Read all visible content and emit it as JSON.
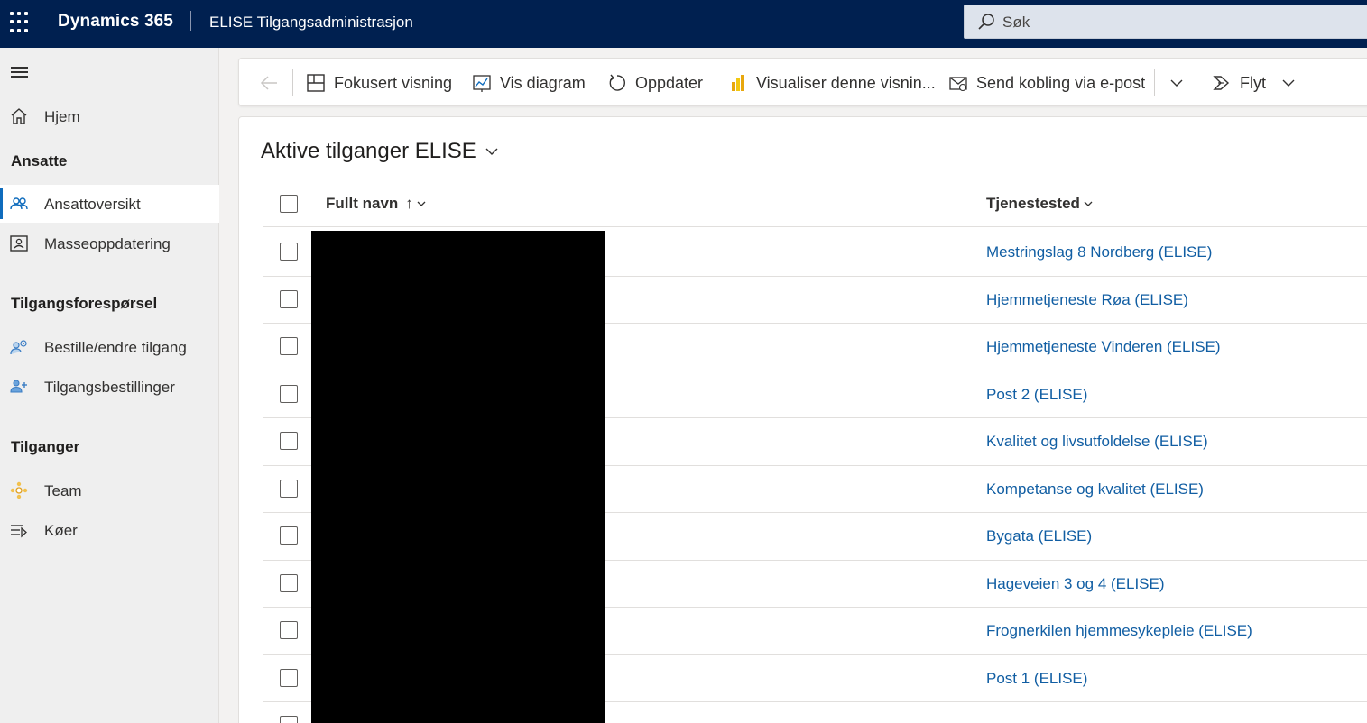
{
  "header": {
    "brand": "Dynamics 365",
    "app_name": "ELISE Tilgangsadministrasjon",
    "search_placeholder": "Søk",
    "icons": [
      "app-launcher-icon",
      "search-icon"
    ]
  },
  "sidebar": {
    "items": [
      {
        "label": "Hjem",
        "icon": "home-icon"
      },
      {
        "group": "Ansatte"
      },
      {
        "label": "Ansattoversikt",
        "icon": "people-icon",
        "active": true
      },
      {
        "label": "Masseoppdatering",
        "icon": "contact-card-icon"
      },
      {
        "group": "Tilgangsforespørsel"
      },
      {
        "label": "Bestille/endre tilgang",
        "icon": "person-settings-icon"
      },
      {
        "label": "Tilgangsbestillinger",
        "icon": "person-add-icon"
      },
      {
        "group": "Tilganger"
      },
      {
        "label": "Team",
        "icon": "team-icon"
      },
      {
        "label": "Køer",
        "icon": "queue-icon"
      }
    ],
    "groups": {
      "ansatte": "Ansatte",
      "tilgangsforesporsel": "Tilgangsforespørsel",
      "tilganger": "Tilganger"
    },
    "labels": {
      "hjem": "Hjem",
      "ansattoversikt": "Ansattoversikt",
      "masseoppdatering": "Masseoppdatering",
      "bestille": "Bestille/endre tilgang",
      "tilgangsbestillinger": "Tilgangsbestillinger",
      "team": "Team",
      "koer": "Køer"
    }
  },
  "commandbar": {
    "fokusert": "Fokusert visning",
    "diagram": "Vis diagram",
    "oppdater": "Oppdater",
    "visualiser": "Visualiser denne visnin...",
    "send": "Send kobling via e-post",
    "flyt": "Flyt"
  },
  "view": {
    "title": "Aktive tilganger ELISE",
    "columns": {
      "full_name": "Fullt navn",
      "full_name_sort": "↑",
      "location": "Tjenestested"
    },
    "rows": [
      {
        "location": "Mestringslag 8 Nordberg (ELISE)"
      },
      {
        "location": "Hjemmetjeneste Røa (ELISE)"
      },
      {
        "location": "Hjemmetjeneste Vinderen (ELISE)"
      },
      {
        "location": "Post 2 (ELISE)"
      },
      {
        "location": "Kvalitet og livsutfoldelse (ELISE)"
      },
      {
        "location": "Kompetanse og kvalitet (ELISE)"
      },
      {
        "location": "Bygata (ELISE)"
      },
      {
        "location": "Hageveien 3 og 4 (ELISE)"
      },
      {
        "location": "Frognerkilen hjemmesykepleie (ELISE)"
      },
      {
        "location": "Post 1 (ELISE)"
      }
    ]
  },
  "colors": {
    "topbar": "#002050",
    "link": "#115ea3",
    "accent": "#0f6cbd"
  }
}
